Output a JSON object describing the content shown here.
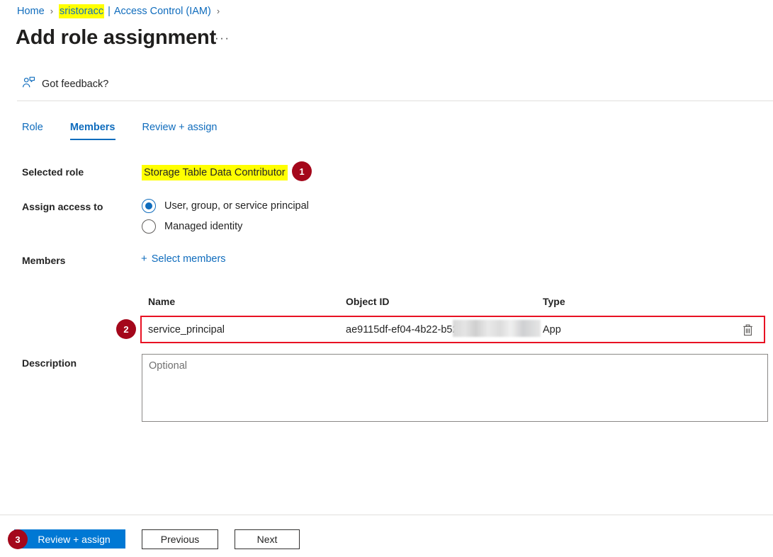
{
  "breadcrumb": {
    "home": "Home",
    "resource": "sristoracc",
    "section": "Access Control (IAM)",
    "separator": "›",
    "pipe": "|"
  },
  "header": {
    "title": "Add role assignment",
    "more_menu": "···"
  },
  "feedback": {
    "label": "Got feedback?",
    "icon": "person-feedback-icon"
  },
  "tabs": [
    {
      "label": "Role",
      "active": false
    },
    {
      "label": "Members",
      "active": true
    },
    {
      "label": "Review + assign",
      "active": false
    }
  ],
  "form": {
    "selected_role_label": "Selected role",
    "selected_role_value": "Storage Table Data Contributor",
    "assign_access_label": "Assign access to",
    "radio_options": [
      {
        "label": "User, group, or service principal",
        "checked": true
      },
      {
        "label": "Managed identity",
        "checked": false
      }
    ],
    "members_label": "Members",
    "select_members_link": "Select members",
    "select_members_plus": "+",
    "description_label": "Description",
    "description_value": "",
    "description_placeholder": "Optional"
  },
  "table": {
    "columns": [
      "Name",
      "Object ID",
      "Type"
    ],
    "rows": [
      {
        "name": "service_principal",
        "object_id": "ae9115df-ef04-4b22-b52",
        "object_id_redacted": true,
        "type": "App",
        "delete_icon": "trash-icon"
      }
    ]
  },
  "footer": {
    "primary_button": "Review + assign",
    "previous_button": "Previous",
    "next_button": "Next"
  },
  "annotations": [
    {
      "number": "1",
      "target": "selected-role-value"
    },
    {
      "number": "2",
      "target": "members-table-row"
    },
    {
      "number": "3",
      "target": "review-assign-button"
    }
  ],
  "colors": {
    "accent_blue": "#0078d4",
    "link_blue": "#0f6cbd",
    "highlight_yellow": "#ffff00",
    "annotation_red": "#a4071b",
    "callout_border_red": "#e81123"
  }
}
